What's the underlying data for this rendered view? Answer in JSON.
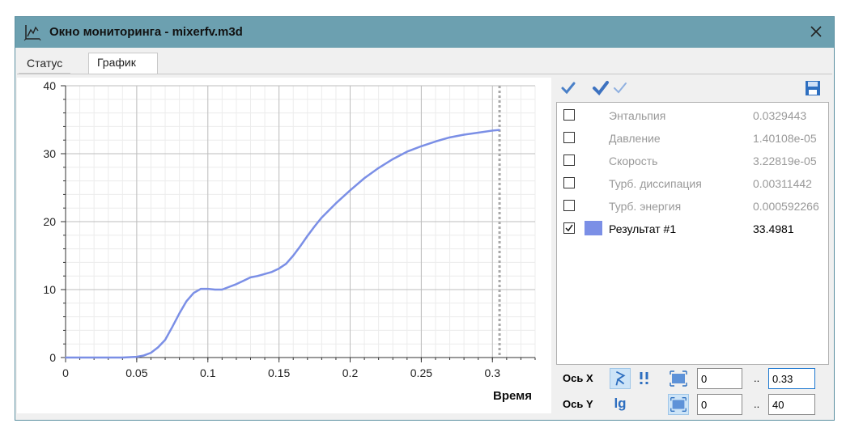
{
  "window": {
    "title": "Окно мониторинга - mixerfv.m3d"
  },
  "tabs": [
    {
      "label": "Статус",
      "active": false
    },
    {
      "label": "График",
      "active": true
    }
  ],
  "toolbar": {
    "icons": [
      "check-icon",
      "check-all-icon",
      "uncheck-all-icon",
      "save-icon"
    ]
  },
  "results": [
    {
      "name": "Энтальпия",
      "value": "0.0329443",
      "checked": false
    },
    {
      "name": "Давление",
      "value": "1.40108e-05",
      "checked": false
    },
    {
      "name": "Скорость",
      "value": "3.22819e-05",
      "checked": false
    },
    {
      "name": "Турб. диссипация",
      "value": "0.00311442",
      "checked": false
    },
    {
      "name": "Турб. энергия",
      "value": "0.000592266",
      "checked": false
    },
    {
      "name": "Результат #1",
      "value": "33.4981",
      "checked": true,
      "color": "#7b8fe6"
    }
  ],
  "axes": {
    "x": {
      "label": "Ось X",
      "min": "0",
      "dots": "..",
      "max": "0.33"
    },
    "y": {
      "label": "Ось Y",
      "log_label": "lg",
      "min": "0",
      "dots": "..",
      "max": "40"
    }
  },
  "chart_data": {
    "type": "line",
    "xlabel": "Время",
    "ylabel": "",
    "xlim": [
      0,
      0.33
    ],
    "ylim": [
      0,
      40
    ],
    "xticks": [
      "0",
      "0.05",
      "0.1",
      "0.15",
      "0.2",
      "0.25",
      "0.3"
    ],
    "yticks": [
      "0",
      "10",
      "20",
      "30",
      "40"
    ],
    "grid": true,
    "cursor_x": 0.305,
    "series": [
      {
        "name": "Результат #1",
        "color": "#7b8fe6",
        "x": [
          0,
          0.02,
          0.04,
          0.05,
          0.055,
          0.06,
          0.065,
          0.07,
          0.075,
          0.08,
          0.085,
          0.09,
          0.095,
          0.1,
          0.105,
          0.11,
          0.115,
          0.12,
          0.125,
          0.13,
          0.135,
          0.14,
          0.145,
          0.15,
          0.155,
          0.16,
          0.165,
          0.17,
          0.175,
          0.18,
          0.19,
          0.2,
          0.21,
          0.22,
          0.23,
          0.24,
          0.25,
          0.26,
          0.27,
          0.28,
          0.29,
          0.3,
          0.305
        ],
        "y": [
          0,
          0,
          0,
          0.1,
          0.3,
          0.7,
          1.5,
          2.6,
          4.5,
          6.5,
          8.3,
          9.5,
          10.1,
          10.1,
          10.0,
          10.0,
          10.4,
          10.8,
          11.3,
          11.8,
          12.0,
          12.3,
          12.6,
          13.1,
          13.8,
          15.0,
          16.4,
          17.9,
          19.3,
          20.6,
          22.7,
          24.6,
          26.4,
          27.9,
          29.2,
          30.3,
          31.1,
          31.8,
          32.4,
          32.8,
          33.1,
          33.4,
          33.5
        ]
      }
    ]
  }
}
